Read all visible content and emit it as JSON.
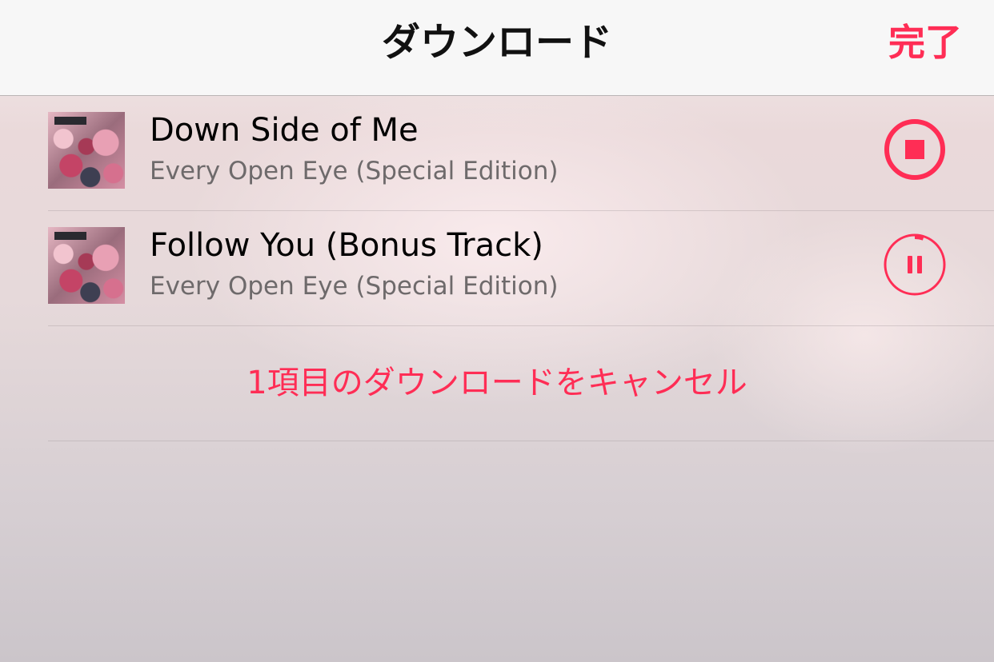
{
  "header": {
    "title": "ダウンロード",
    "done_label": "完了"
  },
  "downloads": [
    {
      "title": "Down Side of Me",
      "album": "Every Open Eye (Special Edition)",
      "state": "stop",
      "control_icon": "stop-icon"
    },
    {
      "title": "Follow You (Bonus Track)",
      "album": "Every Open Eye (Special Edition)",
      "state": "paused",
      "control_icon": "pause-icon",
      "progress": 0.05
    }
  ],
  "cancel": {
    "label": "1項目のダウンロードをキャンセル"
  },
  "colors": {
    "accent": "#ff2d55"
  }
}
